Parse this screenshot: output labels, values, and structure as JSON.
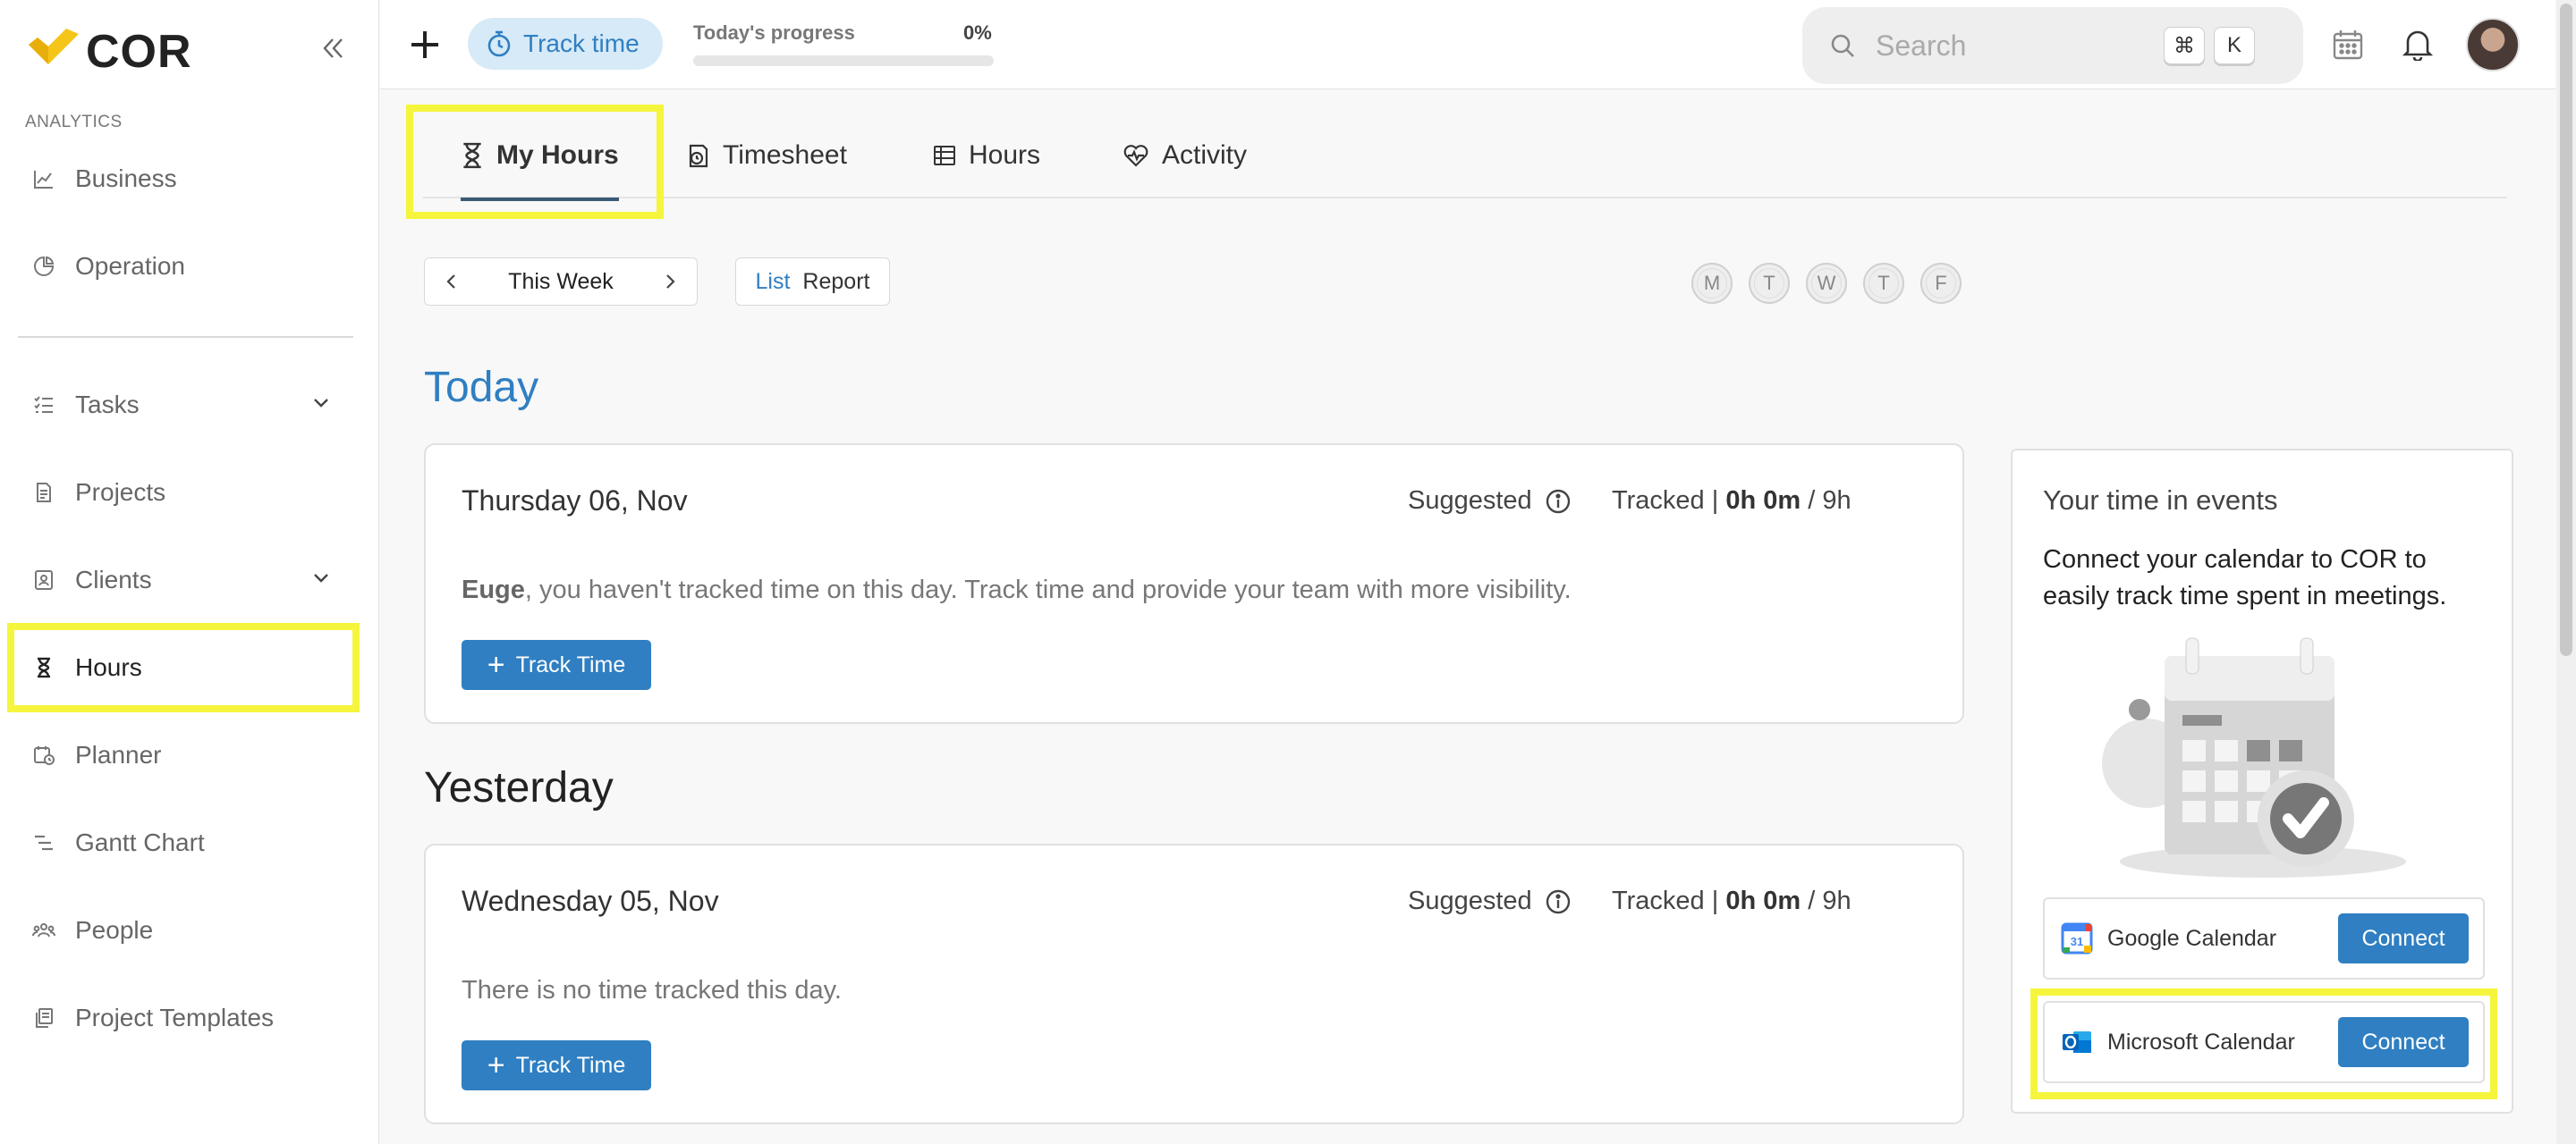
{
  "brand": {
    "name": "COR",
    "accent": "#2f7fc2",
    "logo_color": "#f5c518"
  },
  "sidebar": {
    "section_label": "ANALYTICS",
    "items": [
      {
        "label": "Business",
        "icon": "chart-line-icon"
      },
      {
        "label": "Operation",
        "icon": "pie-chart-icon"
      },
      {
        "label": "Tasks",
        "icon": "checklist-icon",
        "expandable": true
      },
      {
        "label": "Projects",
        "icon": "document-icon"
      },
      {
        "label": "Clients",
        "icon": "contact-card-icon",
        "expandable": true
      },
      {
        "label": "Hours",
        "icon": "hourglass-icon",
        "active": true
      },
      {
        "label": "Planner",
        "icon": "calendar-clock-icon"
      },
      {
        "label": "Gantt Chart",
        "icon": "gantt-icon"
      },
      {
        "label": "People",
        "icon": "people-icon"
      },
      {
        "label": "Project Templates",
        "icon": "templates-icon"
      }
    ]
  },
  "topbar": {
    "track_time_label": "Track time",
    "progress_label": "Today's progress",
    "progress_percent_text": "0%",
    "progress_value": 0,
    "search_placeholder": "Search",
    "shortcut_keys": [
      "⌘",
      "K"
    ]
  },
  "tabs": [
    {
      "label": "My Hours",
      "icon": "hourglass-icon",
      "active": true
    },
    {
      "label": "Timesheet",
      "icon": "timesheet-icon"
    },
    {
      "label": "Hours",
      "icon": "table-icon"
    },
    {
      "label": "Activity",
      "icon": "heart-pulse-icon"
    }
  ],
  "toolbar": {
    "week_label": "This Week",
    "view_options": [
      "List",
      "Report"
    ],
    "selected_view": "List",
    "days": [
      "M",
      "T",
      "W",
      "T",
      "F"
    ]
  },
  "sections": [
    {
      "title": "Today",
      "title_color": "#2f7fc2",
      "card": {
        "date": "Thursday 06, Nov",
        "suggested_label": "Suggested",
        "tracked_label": "Tracked |",
        "tracked_value": "0h 0m",
        "tracked_total": "/ 9h",
        "message_user": "Euge",
        "message": ", you haven't tracked time on this day. Track time and provide your team with more visibility.",
        "button_label": "Track Time"
      }
    },
    {
      "title": "Yesterday",
      "title_color": "#222222",
      "card": {
        "date": "Wednesday 05, Nov",
        "suggested_label": "Suggested",
        "tracked_label": "Tracked |",
        "tracked_value": "0h 0m",
        "tracked_total": "/ 9h",
        "message": "There is no time tracked this day.",
        "button_label": "Track Time"
      }
    }
  ],
  "events_panel": {
    "title": "Your time in events",
    "description": "Connect your calendar to COR to easily track time spent in meetings.",
    "calendars": [
      {
        "name": "Google Calendar",
        "icon": "google-calendar-icon",
        "button": "Connect"
      },
      {
        "name": "Microsoft Calendar",
        "icon": "outlook-icon",
        "button": "Connect"
      }
    ]
  }
}
